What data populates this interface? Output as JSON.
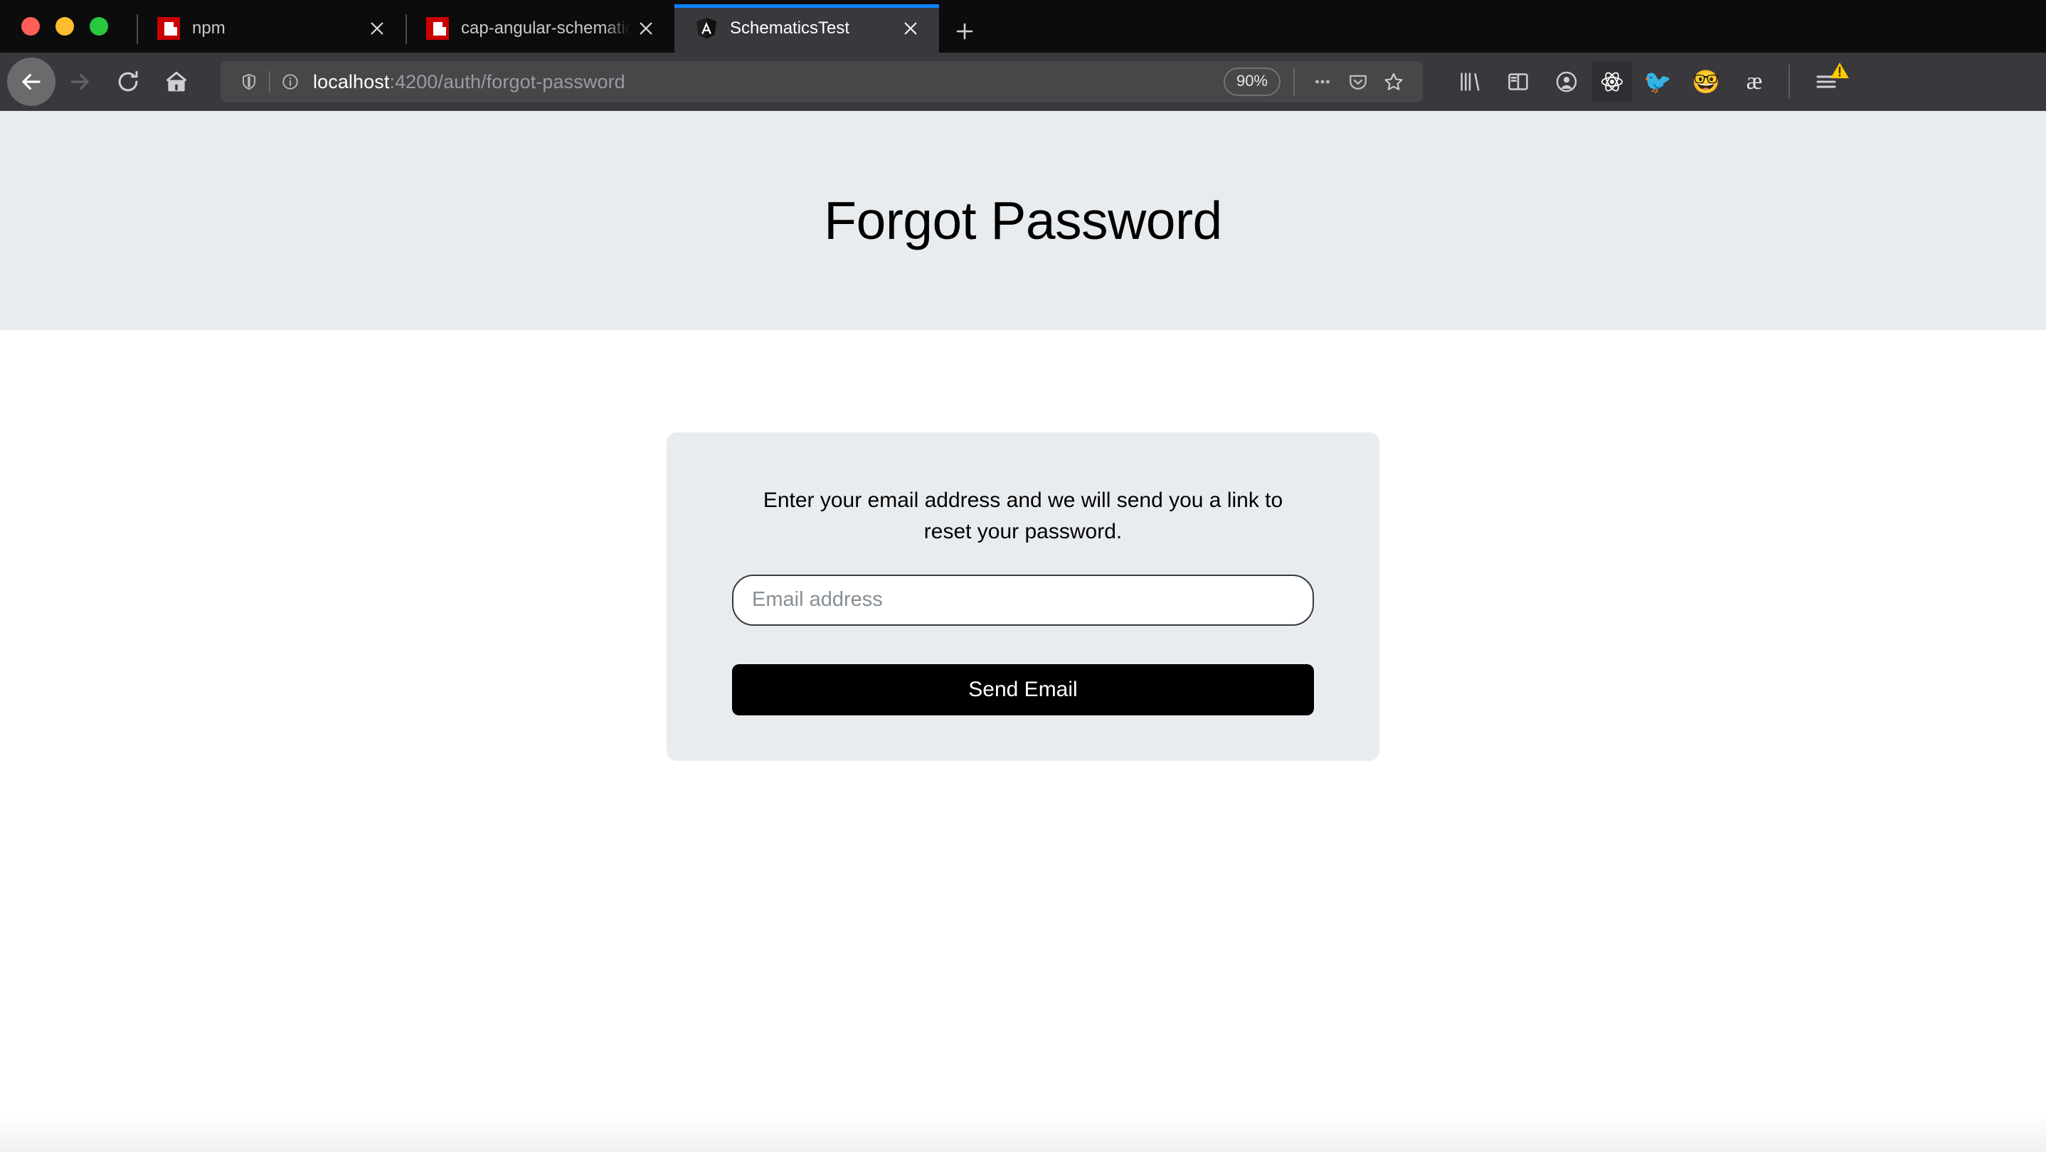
{
  "window": {
    "traffic_lights": [
      "close",
      "minimize",
      "maximize"
    ],
    "colors": {
      "close": "#ff5f57",
      "minimize": "#febc2e",
      "maximize": "#28c840",
      "tabstrip_bg": "#0c0c0d",
      "toolbar_bg": "#38383d",
      "active_tab_accent": "#0a84ff",
      "hero_bg": "#e9ecef",
      "card_bg": "#e9ecef",
      "button_bg": "#000000",
      "warning_badge": "#ffcc00"
    }
  },
  "tabs": [
    {
      "title": "npm",
      "favicon": "npm-favicon",
      "active": false
    },
    {
      "title": "cap-angular-schematic-auth-a",
      "favicon": "npm-favicon",
      "active": false
    },
    {
      "title": "SchematicsTest",
      "favicon": "angular-favicon",
      "active": true
    }
  ],
  "new_tab_label": "+",
  "nav": {
    "back": "back-arrow",
    "forward": "forward-arrow",
    "reload": "reload",
    "home": "home"
  },
  "urlbar": {
    "shield_icon": "tracking-protection-shield",
    "info_icon": "page-info",
    "url_host": "localhost",
    "url_path": ":4200/auth/forgot-password",
    "zoom_level": "90%",
    "page_actions_icon": "ellipsis",
    "pocket_icon": "pocket",
    "bookmark_icon": "star"
  },
  "toolbar_icons": [
    {
      "name": "library-icon",
      "glyph": "library"
    },
    {
      "name": "sidebar-icon",
      "glyph": "sidebar"
    },
    {
      "name": "account-icon",
      "glyph": "account"
    },
    {
      "name": "react-devtools-icon",
      "glyph": "react"
    },
    {
      "name": "extension-bird-icon",
      "glyph": "🐦"
    },
    {
      "name": "extension-face-icon",
      "glyph": "🤓"
    },
    {
      "name": "extension-ae-icon",
      "glyph": "æ"
    }
  ],
  "menu": {
    "hamburger_icon": "hamburger-menu",
    "warning_icon": "warning-triangle"
  },
  "page": {
    "heading": "Forgot Password",
    "card": {
      "description": "Enter your email address and we will send you a link to reset your password.",
      "email_placeholder": "Email address",
      "email_value": "",
      "submit_label": "Send Email"
    }
  }
}
